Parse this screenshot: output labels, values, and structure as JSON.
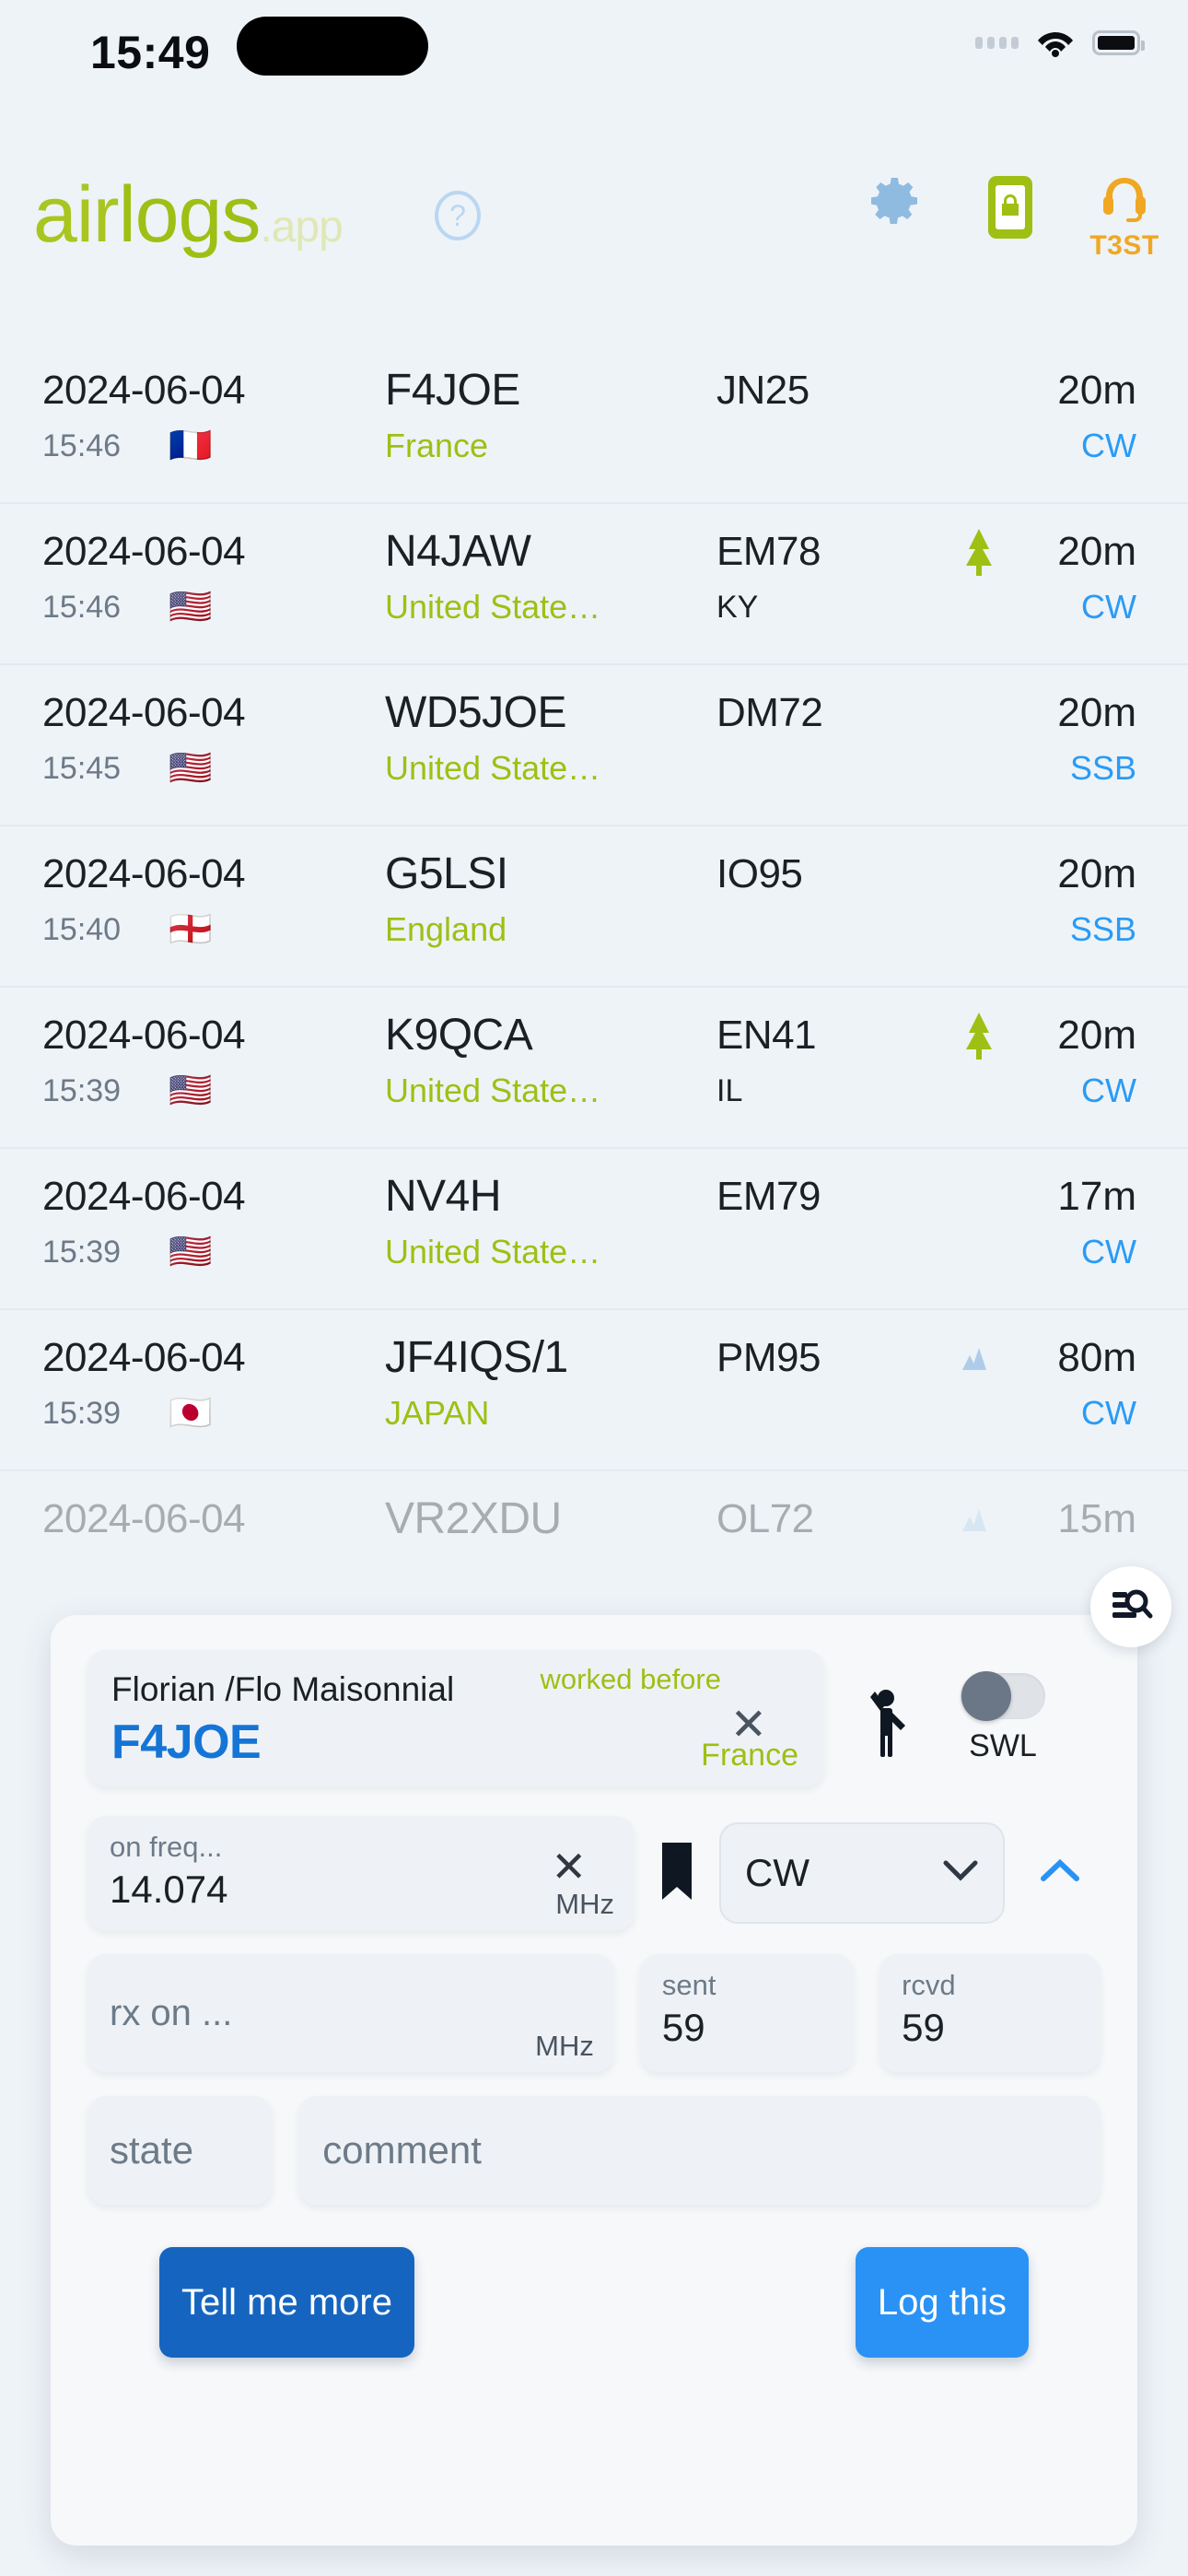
{
  "status_bar": {
    "time": "15:49",
    "signal_icon": "signal-dots-icon",
    "wifi_icon": "wifi-icon",
    "battery_icon": "battery-icon"
  },
  "header": {
    "logo_part1": "air",
    "logo_part2": "logs",
    "logo_part3": ".app",
    "help_icon": "question-circle-icon",
    "settings_icon": "gear-icon",
    "lock_icon": "phone-lock-icon",
    "headset_icon": "headset-icon",
    "station_label": "T3ST",
    "colors": {
      "logo_light": "#a9c520",
      "logo_dark": "#9fbf14",
      "logo_app": "#dfe8b5",
      "gear": "#8fbbe0",
      "lock": "#9fbf14",
      "headset": "#f0a722"
    }
  },
  "log_list": {
    "columns": [
      "date",
      "callsign",
      "grid",
      "marker",
      "band"
    ],
    "rows": [
      {
        "date": "2024-06-04",
        "time": "15:46",
        "flag": "🇫🇷",
        "callsign": "F4JOE",
        "country": "France",
        "grid": "JN25",
        "state": "",
        "marker": "",
        "band": "20m",
        "mode": "CW",
        "faded": false
      },
      {
        "date": "2024-06-04",
        "time": "15:46",
        "flag": "🇺🇸",
        "callsign": "N4JAW",
        "country": "United State…",
        "grid": "EM78",
        "state": "KY",
        "marker": "tree",
        "band": "20m",
        "mode": "CW",
        "faded": false
      },
      {
        "date": "2024-06-04",
        "time": "15:45",
        "flag": "🇺🇸",
        "callsign": "WD5JOE",
        "country": "United State…",
        "grid": "DM72",
        "state": "",
        "marker": "",
        "band": "20m",
        "mode": "SSB",
        "faded": false
      },
      {
        "date": "2024-06-04",
        "time": "15:40",
        "flag": "🏴󠁧󠁢󠁥󠁮󠁧󠁿",
        "callsign": "G5LSI",
        "country": "England",
        "grid": "IO95",
        "state": "",
        "marker": "",
        "band": "20m",
        "mode": "SSB",
        "faded": false
      },
      {
        "date": "2024-06-04",
        "time": "15:39",
        "flag": "🇺🇸",
        "callsign": "K9QCA",
        "country": "United State…",
        "grid": "EN41",
        "state": "IL",
        "marker": "tree",
        "band": "20m",
        "mode": "CW",
        "faded": false
      },
      {
        "date": "2024-06-04",
        "time": "15:39",
        "flag": "🇺🇸",
        "callsign": "NV4H",
        "country": "United State…",
        "grid": "EM79",
        "state": "",
        "marker": "",
        "band": "17m",
        "mode": "CW",
        "faded": false
      },
      {
        "date": "2024-06-04",
        "time": "15:39",
        "flag": "🇯🇵",
        "callsign": "JF4IQS/1",
        "country": "JAPAN",
        "grid": "PM95",
        "state": "",
        "marker": "mountain",
        "band": "80m",
        "mode": "CW",
        "faded": false
      },
      {
        "date": "2024-06-04",
        "time": "",
        "flag": "",
        "callsign": "VR2XDU",
        "country": "",
        "grid": "OL72",
        "state": "",
        "marker": "mountain",
        "band": "15m",
        "mode": "",
        "faded": true
      }
    ]
  },
  "fab": {
    "icon": "manage-search-icon"
  },
  "entry_panel": {
    "callsign_card": {
      "operator_name": "Florian /Flo Maisonnial",
      "callsign": "F4JOE",
      "worked_before": "worked before",
      "country": "France",
      "clear_icon": "close-x-icon"
    },
    "wave_icon": "waving-person-icon",
    "swl_toggle": {
      "label": "SWL",
      "state": "off"
    },
    "frequency": {
      "label": "on freq...",
      "value": "14.074",
      "unit": "MHz",
      "clear_icon": "close-x-icon"
    },
    "bookmark_icon": "bookmark-icon",
    "mode": {
      "value": "CW",
      "chevron_icon": "chevron-down-icon"
    },
    "collapse_icon": "chevron-up-icon",
    "rx_frequency": {
      "placeholder": "rx on ...",
      "value": "",
      "unit": "MHz"
    },
    "sent": {
      "label": "sent",
      "value": "59"
    },
    "rcvd": {
      "label": "rcvd",
      "value": "59"
    },
    "state_field": {
      "placeholder": "state",
      "value": ""
    },
    "comment_field": {
      "placeholder": "comment",
      "value": ""
    },
    "buttons": {
      "tell_more": "Tell me more",
      "log_this": "Log this",
      "tell_more_color": "#1565c0",
      "log_this_color": "#2a92f5"
    }
  }
}
